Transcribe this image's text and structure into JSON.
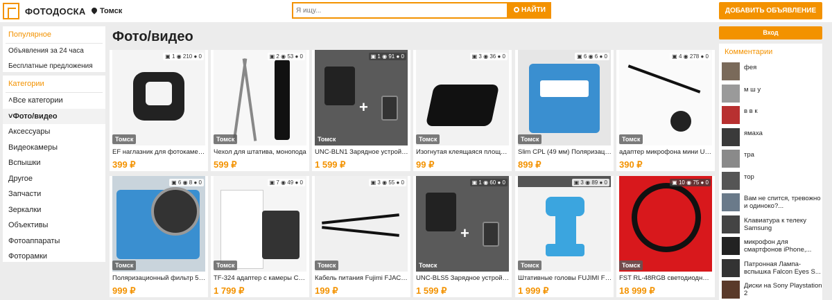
{
  "header": {
    "brand": "ФОТОДОСКА",
    "city": "Томск",
    "search_placeholder": "Я ищу...",
    "search_button": "НАЙТИ",
    "add_button": "ДОБАВИТЬ ОБЪЯВЛЕНИЕ"
  },
  "popular": {
    "title": "Популярное",
    "links": [
      "Объявления за 24 часа",
      "Бесплатные предложения"
    ]
  },
  "categories": {
    "title": "Категории",
    "all": "Все категории",
    "current": "Фото/видео",
    "items": [
      "Аксессуары",
      "Видеокамеры",
      "Вспышки",
      "Другое",
      "Запчасти",
      "Зеркалки",
      "Объективы",
      "Фотоаппараты",
      "Фоторамки"
    ]
  },
  "main": {
    "title": "Фото/видео",
    "city_badge": "Томск",
    "listings": [
      {
        "title": "EF наглазник для фотокамер ...",
        "price": "399 ₽",
        "photos": "1",
        "views": "210",
        "comments": "0"
      },
      {
        "title": "Чехол для штатива, монопода",
        "price": "599 ₽",
        "photos": "2",
        "views": "53",
        "comments": "0"
      },
      {
        "title": "UNC-BLN1 Зарядное устройст...",
        "price": "1 599 ₽",
        "photos": "1",
        "views": "91",
        "comments": "0"
      },
      {
        "title": "Изогнутая клеящаяся площад...",
        "price": "99 ₽",
        "photos": "3",
        "views": "36",
        "comments": "0"
      },
      {
        "title": "Slim CPL (49 мм) Поляризацио...",
        "price": "899 ₽",
        "photos": "6",
        "views": "6",
        "comments": "0"
      },
      {
        "title": "адаптер микрофона мини USB...",
        "price": "390 ₽",
        "photos": "4",
        "views": "278",
        "comments": "0"
      },
      {
        "title": "Поляризационный фильтр 55 ...",
        "price": "999 ₽",
        "photos": "6",
        "views": "8",
        "comments": "0"
      },
      {
        "title": "TF-324 адаптер с камеры Can...",
        "price": "1 799 ₽",
        "photos": "7",
        "views": "49",
        "comments": "0"
      },
      {
        "title": "Кабель питания Fujimi FJAC . C...",
        "price": "199 ₽",
        "photos": "3",
        "views": "55",
        "comments": "0"
      },
      {
        "title": "UNC-BLS5 Зарядное устройст...",
        "price": "1 599 ₽",
        "photos": "1",
        "views": "60",
        "comments": "0"
      },
      {
        "title": "Штативные головы FUJIMI FL...",
        "price": "1 999 ₽",
        "photos": "3",
        "views": "89",
        "comments": "0"
      },
      {
        "title": "FST RL-48RGB светодиодный к...",
        "price": "18 999 ₽",
        "photos": "10",
        "views": "75",
        "comments": "0"
      }
    ]
  },
  "right": {
    "login": "Вход",
    "comments_title": "Комментарии",
    "comments": [
      "фея",
      "м ш у",
      "в в к",
      "ямаха",
      "тра",
      "тор",
      "Вам не спится, тревожно и одиноко?...",
      "Клавиатура к телеку Samsung",
      "микрофон для смартфонов iPhone,...",
      "Патронная Лампа-вспышка Falcon Eyes S...",
      "Диски на Sony Playstation 2"
    ]
  },
  "colors": {
    "accent": "#f39200"
  }
}
